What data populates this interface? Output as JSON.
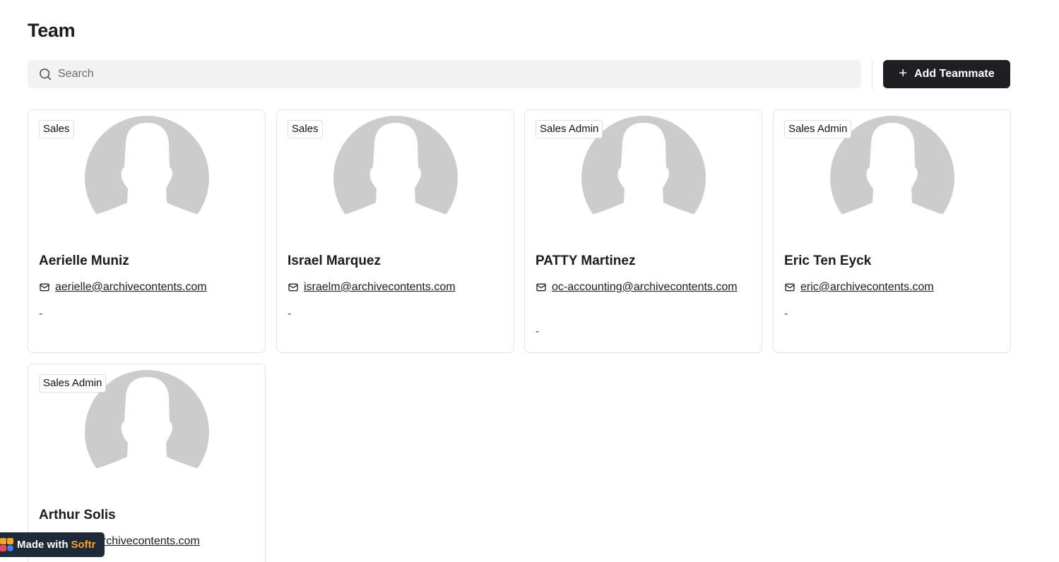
{
  "page": {
    "title": "Team"
  },
  "search": {
    "placeholder": "Search"
  },
  "toolbar": {
    "add_label": "Add Teammate"
  },
  "icons": {
    "search": "search-icon",
    "mail": "mail-icon",
    "plus": "plus-icon"
  },
  "members": [
    {
      "badge": "Sales",
      "name": "Aerielle Muniz",
      "email": "aerielle@archivecontents.com",
      "note": "-"
    },
    {
      "badge": "Sales",
      "name": "Israel Marquez",
      "email": "israelm@archivecontents.com",
      "note": "-"
    },
    {
      "badge": "Sales Admin",
      "name": "PATTY Martinez",
      "email": "oc-accounting@archivecontents.com",
      "note": "-"
    },
    {
      "badge": "Sales Admin",
      "name": "Eric Ten Eyck",
      "email": "eric@archivecontents.com",
      "note": "-"
    },
    {
      "badge": "Sales Admin",
      "name": "Arthur Solis",
      "email": "arthur@archivecontents.com",
      "note": "-"
    }
  ],
  "footer_badge": {
    "prefix": "Made with",
    "brand": "Softr"
  },
  "colors": {
    "primary_button": "#1f1f23",
    "avatar_placeholder": "#cccccc",
    "softr_accent": "#f5a623",
    "softr_bg": "#1f2a38"
  }
}
